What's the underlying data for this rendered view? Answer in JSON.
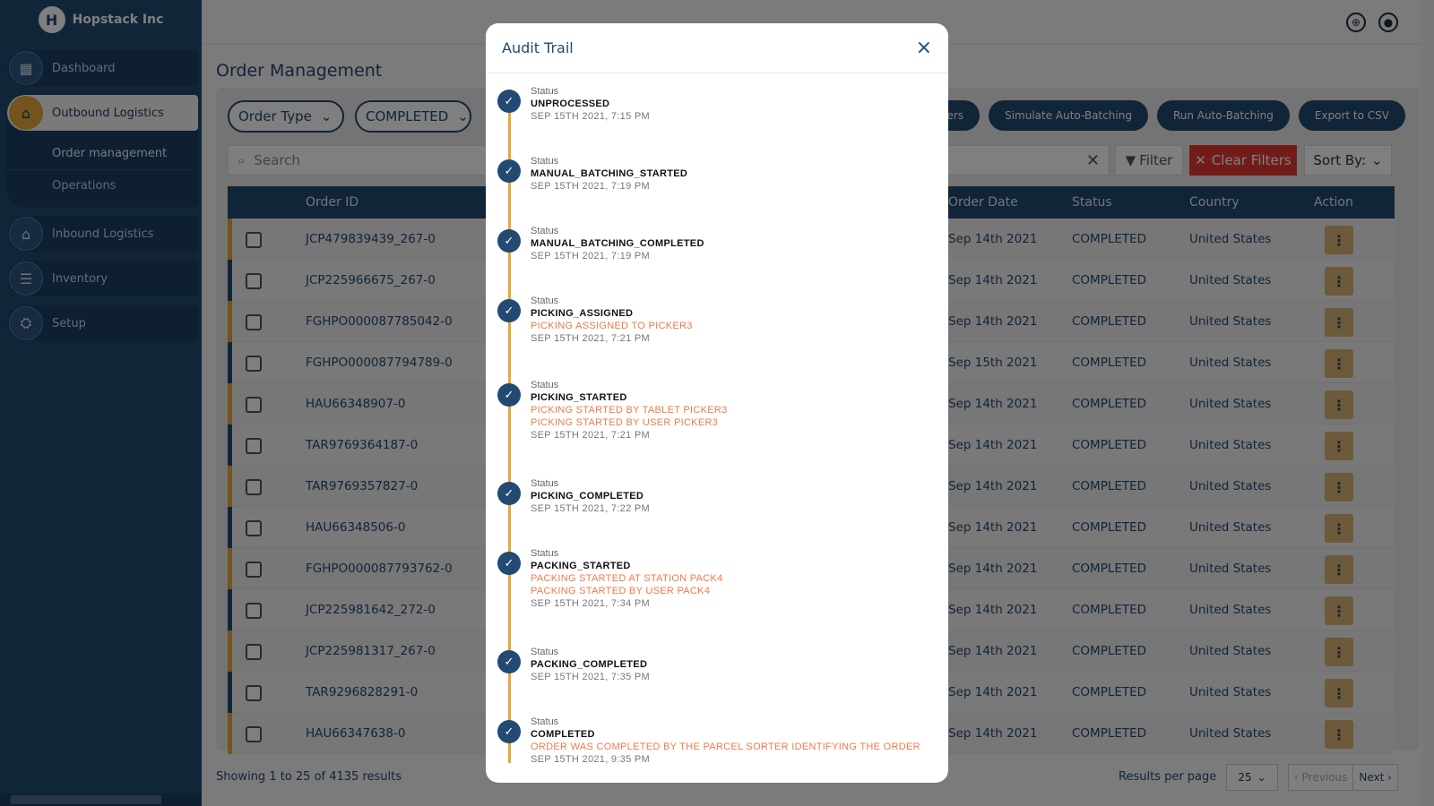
{
  "brand": {
    "logo_letter": "H",
    "name": "Hopstack Inc"
  },
  "sidebar": {
    "items": [
      {
        "label": "Dashboard",
        "icon": "dashboard-icon"
      },
      {
        "label": "Outbound Logistics",
        "icon": "warehouse-icon"
      },
      {
        "label": "Inbound Logistics",
        "icon": "warehouse-inbound-icon"
      },
      {
        "label": "Inventory",
        "icon": "list-icon"
      },
      {
        "label": "Setup",
        "icon": "setup-icon"
      }
    ],
    "sub_items": [
      {
        "label": "Order management"
      },
      {
        "label": "Operations"
      }
    ]
  },
  "header": {
    "page_title": "Order Management"
  },
  "filters": {
    "order_type": "Order Type",
    "status": "COMPLETED"
  },
  "actions": {
    "orders_label": "rders",
    "simulate": "Simulate Auto-Batching",
    "run": "Run Auto-Batching",
    "export": "Export to CSV"
  },
  "search": {
    "placeholder": "Search"
  },
  "toolbar": {
    "filter": "Filter",
    "clear_filters": "Clear Filters",
    "sort_by": "Sort By:"
  },
  "table": {
    "columns": {
      "order_id": "Order ID",
      "order_date": "Order Date",
      "status": "Status",
      "country": "Country",
      "action": "Action"
    },
    "rows": [
      {
        "order_id": "JCP479839439_267-0",
        "order_date": "Sep 14th 2021",
        "status": "COMPLETED",
        "country": "United States"
      },
      {
        "order_id": "JCP225966675_267-0",
        "order_date": "Sep 14th 2021",
        "status": "COMPLETED",
        "country": "United States"
      },
      {
        "order_id": "FGHPO000087785042-0",
        "order_date": "Sep 14th 2021",
        "status": "COMPLETED",
        "country": "United States"
      },
      {
        "order_id": "FGHPO000087794789-0",
        "order_date": "Sep 15th 2021",
        "status": "COMPLETED",
        "country": "United States"
      },
      {
        "order_id": "HAU66348907-0",
        "order_date": "Sep 14th 2021",
        "status": "COMPLETED",
        "country": "United States"
      },
      {
        "order_id": "TAR9769364187-0",
        "order_date": "Sep 14th 2021",
        "status": "COMPLETED",
        "country": "United States"
      },
      {
        "order_id": "TAR9769357827-0",
        "order_date": "Sep 14th 2021",
        "status": "COMPLETED",
        "country": "United States"
      },
      {
        "order_id": "HAU66348506-0",
        "order_date": "Sep 14th 2021",
        "status": "COMPLETED",
        "country": "United States"
      },
      {
        "order_id": "FGHPO000087793762-0",
        "order_date": "Sep 14th 2021",
        "status": "COMPLETED",
        "country": "United States"
      },
      {
        "order_id": "JCP225981642_272-0",
        "order_date": "Sep 14th 2021",
        "status": "COMPLETED",
        "country": "United States"
      },
      {
        "order_id": "JCP225981317_267-0",
        "order_date": "Sep 14th 2021",
        "status": "COMPLETED",
        "country": "United States"
      },
      {
        "order_id": "TAR9296828291-0",
        "order_date": "Sep 14th 2021",
        "status": "COMPLETED",
        "country": "United States"
      },
      {
        "order_id": "HAU66347638-0",
        "order_date": "Sep 14th 2021",
        "status": "COMPLETED",
        "country": "United States"
      }
    ]
  },
  "footer": {
    "showing": "Showing 1 to 25 of 4135 results",
    "results_per_page_label": "Results per page",
    "results_per_page_value": "25",
    "previous": "Previous",
    "next": "Next"
  },
  "modal": {
    "title": "Audit Trail",
    "close_icon": "×",
    "entries": [
      {
        "label": "Status",
        "status": "UNPROCESSED",
        "notes": [],
        "date": "SEP 15TH 2021, 7:15 PM"
      },
      {
        "label": "Status",
        "status": "MANUAL_BATCHING_STARTED",
        "notes": [],
        "date": "SEP 15TH 2021, 7:19 PM"
      },
      {
        "label": "Status",
        "status": "MANUAL_BATCHING_COMPLETED",
        "notes": [],
        "date": "SEP 15TH 2021, 7:19 PM"
      },
      {
        "label": "Status",
        "status": "PICKING_ASSIGNED",
        "notes": [
          "PICKING ASSIGNED TO PICKER3"
        ],
        "date": "SEP 15TH 2021, 7:21 PM"
      },
      {
        "label": "Status",
        "status": "PICKING_STARTED",
        "notes": [
          "PICKING STARTED BY TABLET PICKER3",
          "PICKING STARTED BY USER PICKER3"
        ],
        "date": "SEP 15TH 2021, 7:21 PM"
      },
      {
        "label": "Status",
        "status": "PICKING_COMPLETED",
        "notes": [],
        "date": "SEP 15TH 2021, 7:22 PM"
      },
      {
        "label": "Status",
        "status": "PACKING_STARTED",
        "notes": [
          "PACKING STARTED AT STATION PACK4",
          "PACKING STARTED BY USER PACK4"
        ],
        "date": "SEP 15TH 2021, 7:34 PM"
      },
      {
        "label": "Status",
        "status": "PACKING_COMPLETED",
        "notes": [],
        "date": "SEP 15TH 2021, 7:35 PM"
      },
      {
        "label": "Status",
        "status": "COMPLETED",
        "notes": [
          "ORDER WAS COMPLETED BY THE PARCEL SORTER IDENTIFYING THE ORDER"
        ],
        "date": "SEP 15TH 2021, 9:35 PM"
      }
    ]
  }
}
